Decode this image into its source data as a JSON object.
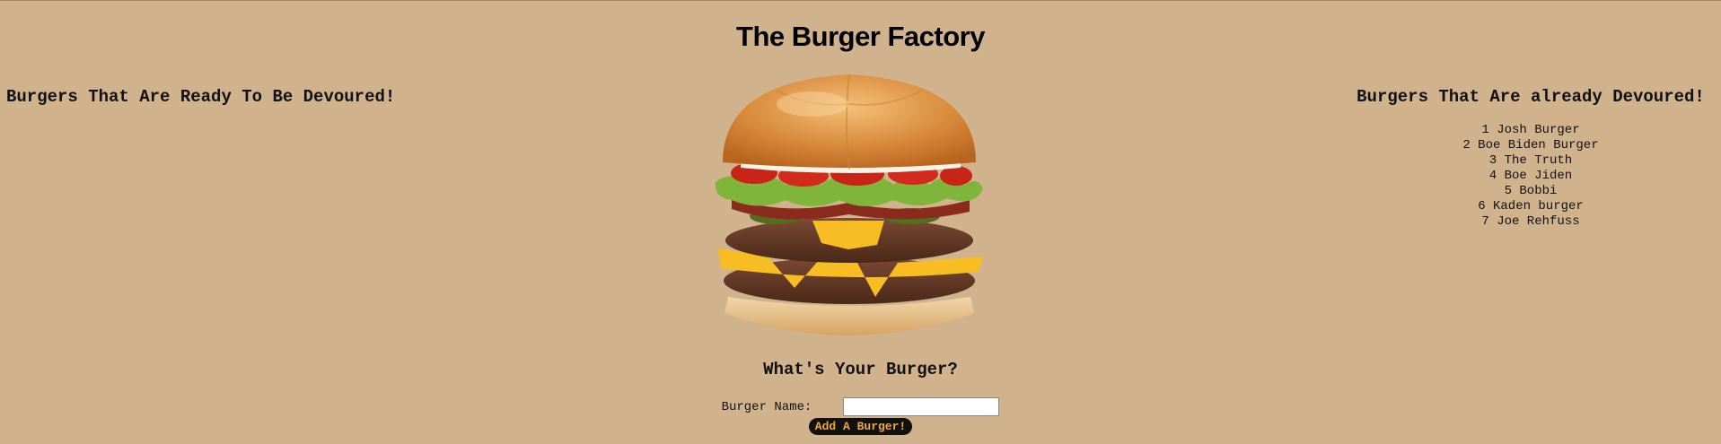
{
  "header": {
    "title": "The Burger Factory"
  },
  "ready": {
    "heading": "Burgers That Are Ready To Be Devoured!"
  },
  "devoured": {
    "heading": "Burgers That Are already Devoured!",
    "items": [
      "1 Josh Burger",
      "2 Boe Biden Burger",
      "3 The Truth",
      "4 Boe Jiden",
      "5 Bobbi",
      "6 Kaden burger",
      "7 Joe Rehfuss"
    ]
  },
  "form": {
    "heading": "What's Your Burger?",
    "name_label": "Burger Name:",
    "name_value": "",
    "submit_label": "Add A Burger!"
  },
  "colors": {
    "background": "#d0b38d",
    "button_bg": "#111111",
    "button_text": "#f0a838"
  }
}
